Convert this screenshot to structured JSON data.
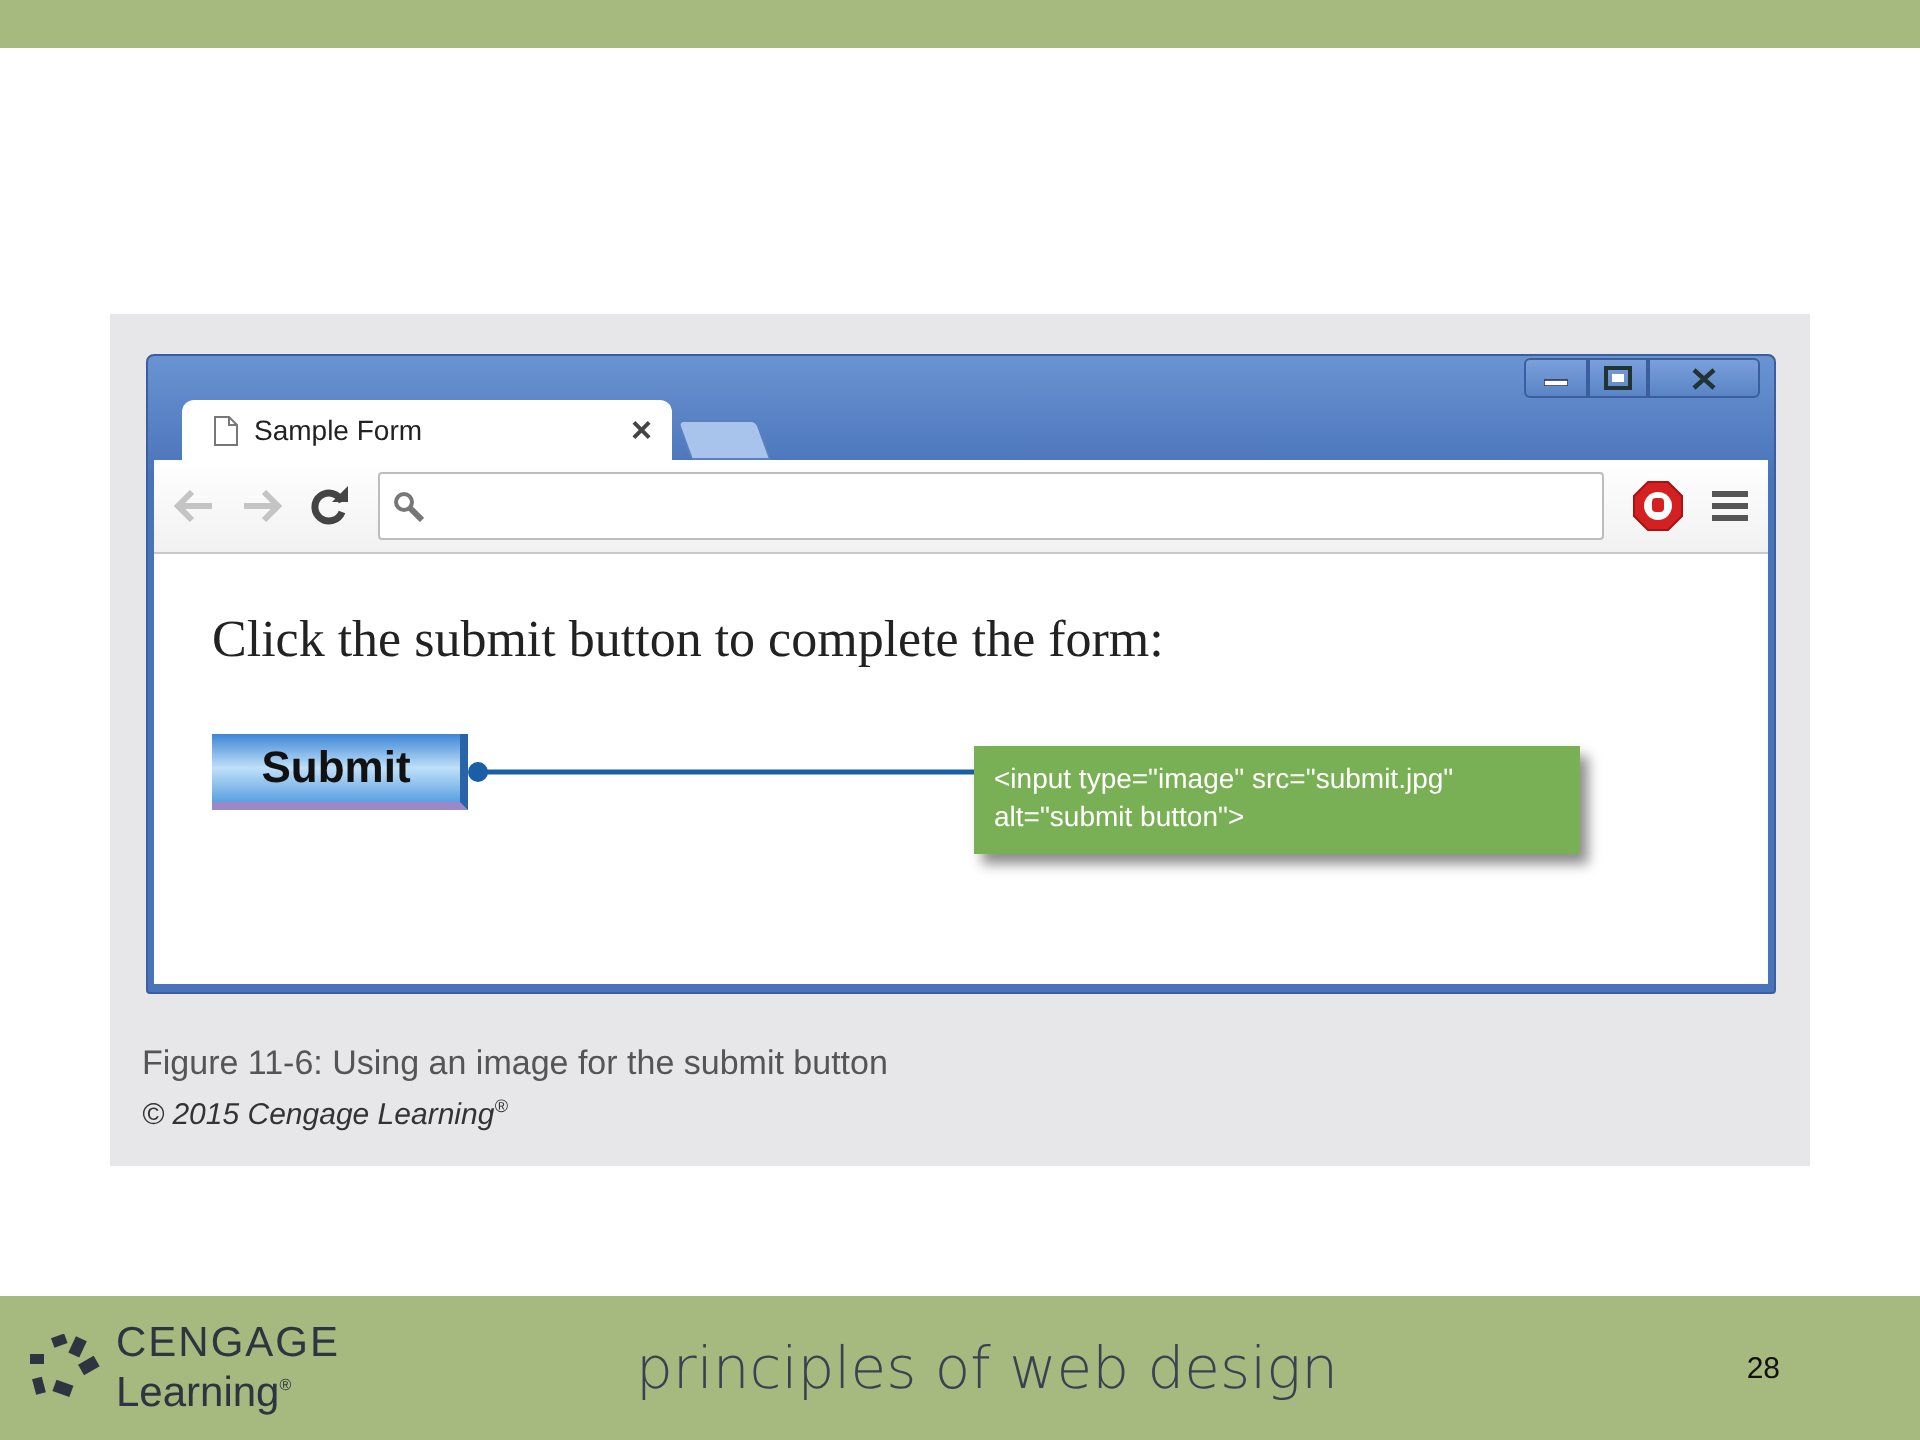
{
  "browser": {
    "tab": {
      "title": "Sample Form",
      "close": "×"
    },
    "page": {
      "heading": "Click the submit button to complete the form:",
      "submit_button": "Submit",
      "callout_lines": [
        "<input type=\"image\" src=\"submit.jpg\"",
        "alt=\"submit button\">"
      ]
    }
  },
  "figure": {
    "caption": "Figure 11-6: Using an image for the submit button",
    "credit": "© 2015 Cengage Learning$^{®}$"
  },
  "footer": {
    "logo_top": "CENGAGE",
    "logo_bottom": "Learning$^{®}$",
    "title": "principles of web design",
    "page_number": "28"
  }
}
